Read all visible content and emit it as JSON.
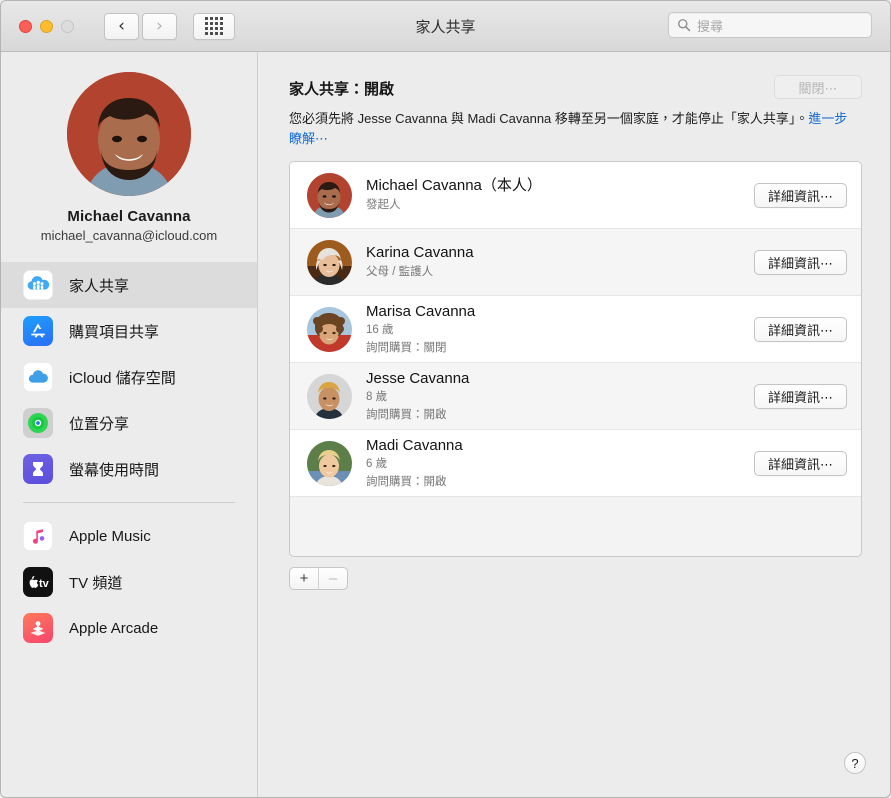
{
  "window": {
    "title": "家人共享",
    "traffic_lights": [
      "close",
      "minimize",
      "zoom"
    ],
    "back_icon": "chevron-left-icon",
    "forward_icon": "chevron-right-icon",
    "grid_icon": "show-all-grid-icon"
  },
  "search": {
    "placeholder": "搜尋",
    "value": "",
    "icon": "search-icon"
  },
  "sidebar": {
    "profile": {
      "name": "Michael Cavanna",
      "email": "michael_cavanna@icloud.com",
      "avatar": "user-avatar"
    },
    "items": [
      {
        "label": "家人共享",
        "icon": "family-sharing-icon",
        "selected": true
      },
      {
        "label": "購買項目共享",
        "icon": "app-store-icon",
        "selected": false
      },
      {
        "label": "iCloud 儲存空間",
        "icon": "icloud-icon",
        "selected": false
      },
      {
        "label": "位置分享",
        "icon": "find-my-icon",
        "selected": false
      },
      {
        "label": "螢幕使用時間",
        "icon": "screen-time-icon",
        "selected": false
      }
    ],
    "media_items": [
      {
        "label": "Apple Music",
        "icon": "apple-music-icon"
      },
      {
        "label": "TV 頻道",
        "icon": "apple-tv-icon"
      },
      {
        "label": "Apple Arcade",
        "icon": "apple-arcade-icon"
      }
    ]
  },
  "main": {
    "heading": "家人共享：開啟",
    "turn_off_label": "關閉⋯",
    "turn_off_disabled": true,
    "description_text": "您必須先將 Jesse Cavanna 與 Madi Cavanna 移轉至另一個家庭，才能停止「家人共享」。",
    "description_link": "進一步瞭解⋯",
    "members": [
      {
        "name": "Michael Cavanna（本人）",
        "role": "發起人",
        "extra": "",
        "button": "詳細資訊⋯",
        "avatar": "avatar-michael"
      },
      {
        "name": "Karina Cavanna",
        "role": "父母 / 監護人",
        "extra": "",
        "button": "詳細資訊⋯",
        "avatar": "avatar-karina"
      },
      {
        "name": "Marisa Cavanna",
        "role": "16 歲",
        "extra": "詢問購買：關閉",
        "button": "詳細資訊⋯",
        "avatar": "avatar-marisa"
      },
      {
        "name": "Jesse Cavanna",
        "role": "8 歲",
        "extra": "詢問購買：開啟",
        "button": "詳細資訊⋯",
        "avatar": "avatar-jesse"
      },
      {
        "name": "Madi Cavanna",
        "role": "6 歲",
        "extra": "詢問購買：開啟",
        "button": "詳細資訊⋯",
        "avatar": "avatar-madi"
      }
    ],
    "add_label": "+",
    "remove_label": "–",
    "remove_disabled": true,
    "help_label": "?"
  },
  "colors": {
    "link": "#1169d7",
    "selected_row": "#dcdcdc",
    "window_bg": "#ececec",
    "list_bg": "#f3f3f3"
  }
}
